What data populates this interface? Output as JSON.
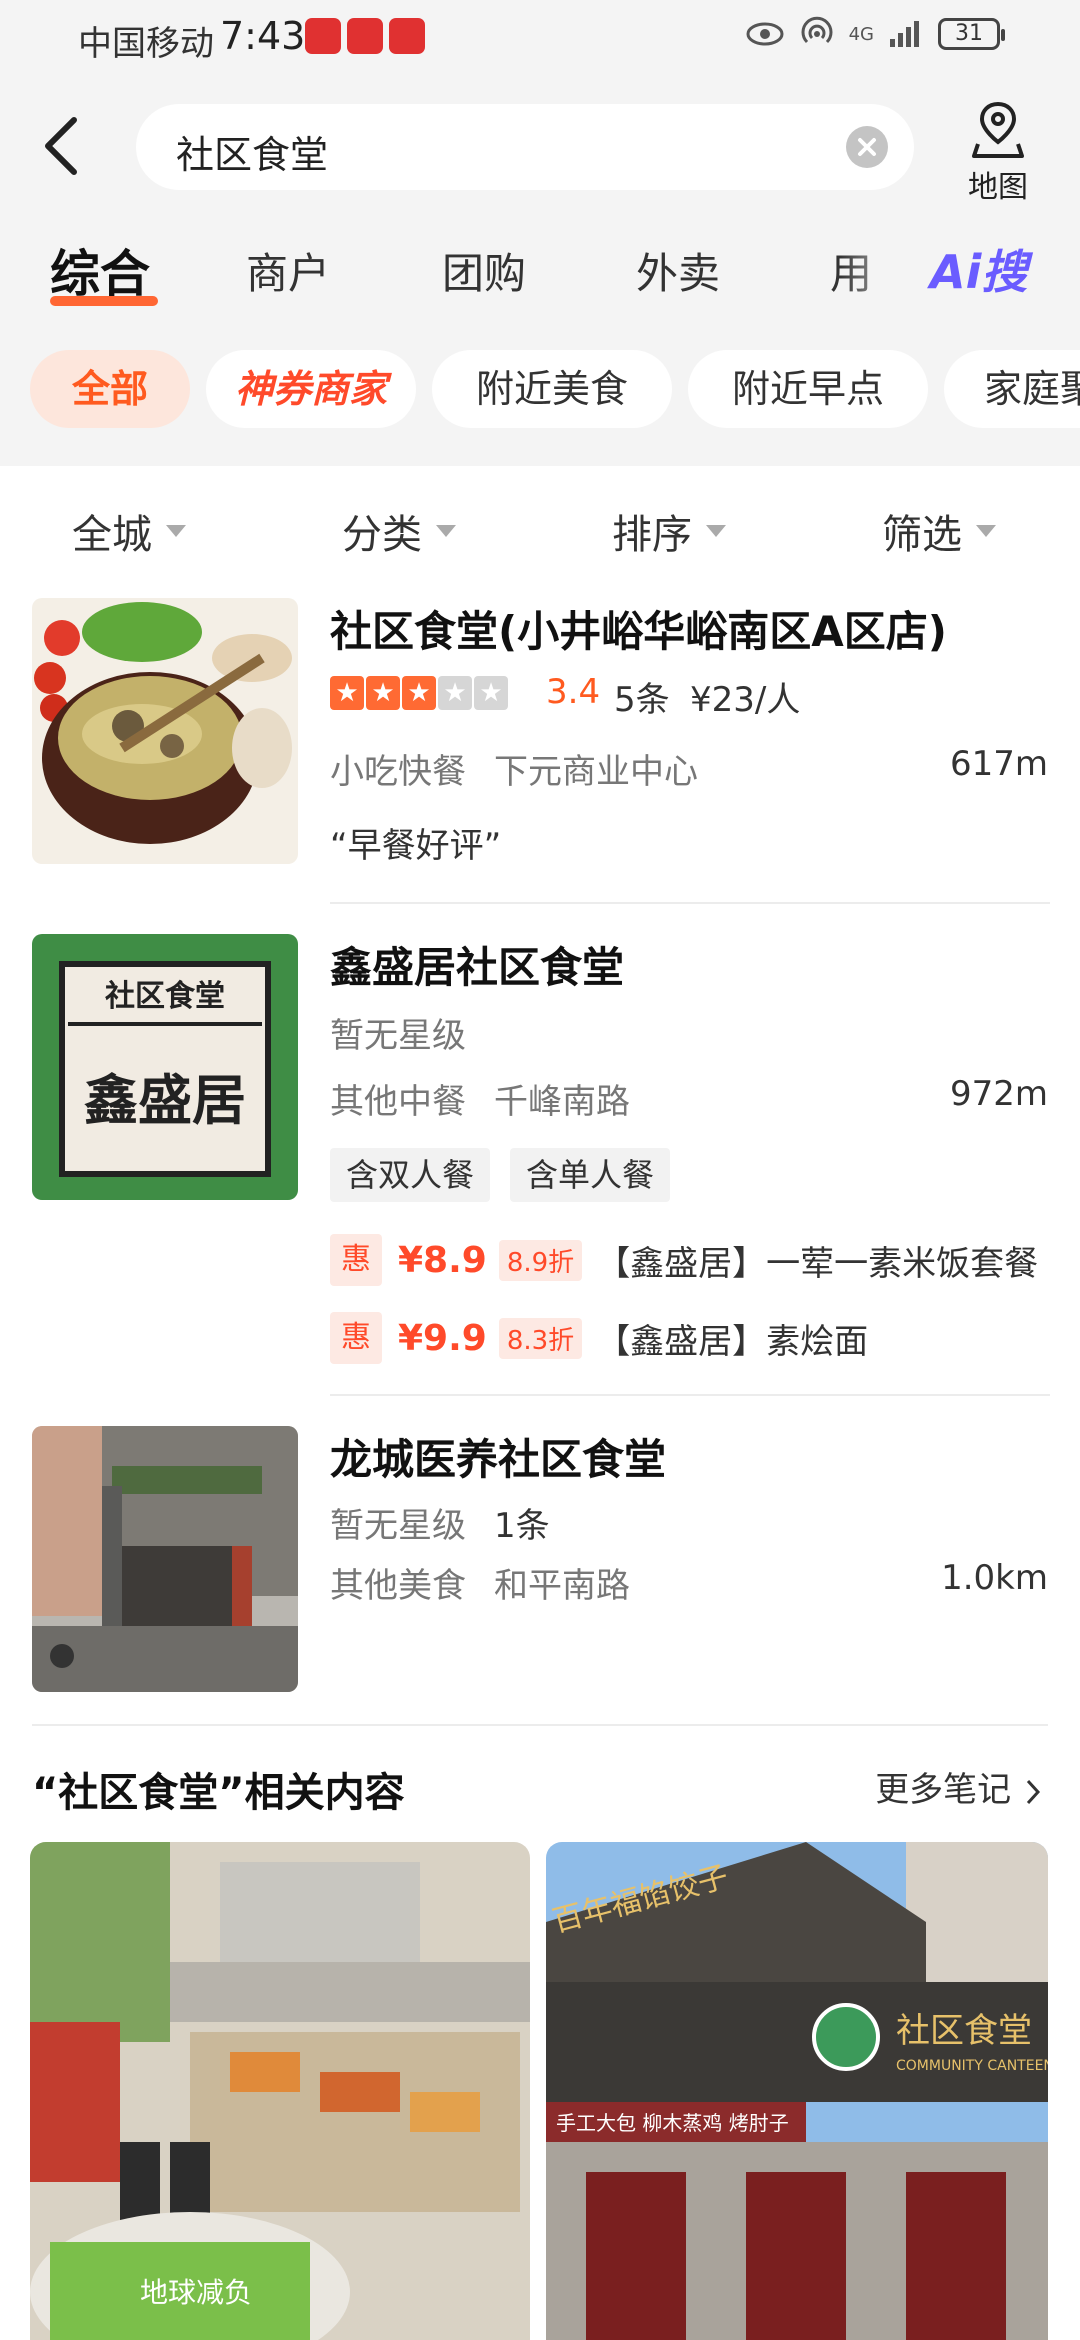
{
  "status_bar": {
    "carrier": "中国移动",
    "time": "7:43",
    "network": "4G",
    "battery": "31"
  },
  "search": {
    "query": "社区食堂",
    "map_label": "地图"
  },
  "tabs": [
    {
      "label": "综合",
      "active": true
    },
    {
      "label": "商户"
    },
    {
      "label": "团购"
    },
    {
      "label": "外卖"
    },
    {
      "label": "用"
    }
  ],
  "ai_tab": "Ai搜",
  "chips": [
    "全部",
    "神券商家",
    "附近美食",
    "附近早点",
    "家庭聚"
  ],
  "sort": [
    "全城",
    "分类",
    "排序",
    "筛选"
  ],
  "listings": [
    {
      "title": "社区食堂(小井峪华峪南区A区店)",
      "rating": "3.4",
      "reviews": "5条",
      "price": "¥23/人",
      "category": "小吃快餐",
      "area": "下元商业中心",
      "distance": "617m",
      "quote": "“早餐好评”"
    },
    {
      "title": "鑫盛居社区食堂",
      "rating_text": "暂无星级",
      "category": "其他中餐",
      "area": "千峰南路",
      "distance": "972m",
      "tags": [
        "含双人餐",
        "含单人餐"
      ],
      "deals": [
        {
          "badge": "惠",
          "price": "¥8.9",
          "discount": "8.9折",
          "name": "【鑫盛居】一荤一素米饭套餐"
        },
        {
          "badge": "惠",
          "price": "¥9.9",
          "discount": "8.3折",
          "name": "【鑫盛居】素烩面"
        }
      ],
      "sign_top": "社区食堂",
      "sign_main": "鑫盛居"
    },
    {
      "title": "龙城医养社区食堂",
      "rating_text": "暂无星级",
      "reviews": "1条",
      "category": "其他美食",
      "area": "和平南路",
      "distance": "1.0km"
    }
  ],
  "related": {
    "title": "“社区食堂”相关内容",
    "more": "更多笔记"
  },
  "photo_signs": {
    "p1_banner": "地球减负",
    "p2_sign": "百年福馅饺子",
    "p2_name": "社区食堂",
    "p2_name_en": "COMMUNITY CANTEEN",
    "p2_banner": "手工大包   柳木蒸鸡   烤肘子"
  },
  "colors": {
    "accent": "#ff5a1f",
    "ai": "#6a5cff",
    "background": "#f4f4f4"
  }
}
